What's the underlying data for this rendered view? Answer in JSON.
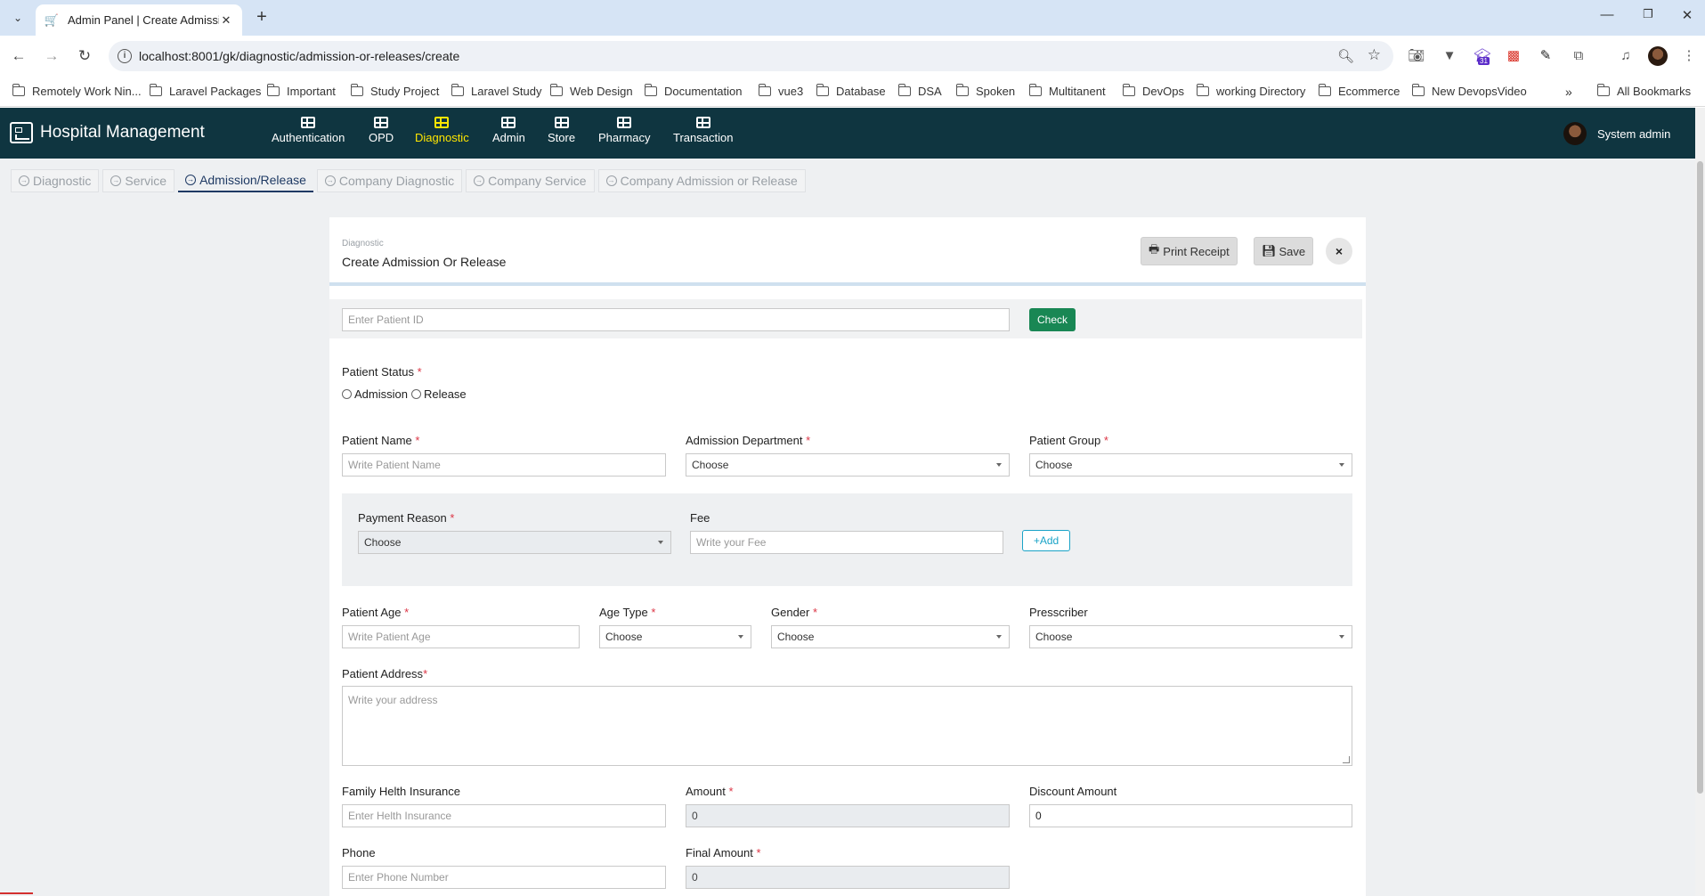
{
  "browser": {
    "tab_title": "Admin Panel | Create Admission",
    "url": "localhost:8001/gk/diagnostic/admission-or-releases/create",
    "calendar_badge": "31",
    "bookmarks": [
      "Remotely Work Nin...",
      "Laravel Packages",
      "Important",
      "Study Project",
      "Laravel Study",
      "Web Design",
      "Documentation",
      "vue3",
      "Database",
      "DSA",
      "Spoken",
      "Multitanent",
      "DevOps",
      "working Directory",
      "Ecommerce",
      "New DevopsVideo"
    ],
    "all_bookmarks": "All Bookmarks"
  },
  "header": {
    "brand": "Hospital Management",
    "nav": [
      "Authentication",
      "OPD",
      "Diagnostic",
      "Admin",
      "Store",
      "Pharmacy",
      "Transaction"
    ],
    "active_nav": "Diagnostic",
    "user": "System admin"
  },
  "subnav": [
    "Diagnostic",
    "Service",
    "Admission/Release",
    "Company Diagnostic",
    "Company Service",
    "Company Admission or Release"
  ],
  "card": {
    "breadcrumb": "Diagnostic",
    "title": "Create Admission Or Release",
    "print_label": "Print Receipt",
    "save_label": "Save",
    "close_label": "×"
  },
  "form": {
    "patient_id_placeholder": "Enter Patient ID",
    "check_label": "Check",
    "patient_status_label": "Patient Status",
    "status_options": [
      "Admission",
      "Release"
    ],
    "patient_name_label": "Patient Name",
    "patient_name_placeholder": "Write Patient Name",
    "admission_department_label": "Admission Department",
    "patient_group_label": "Patient Group",
    "choose": "Choose",
    "payment_reason_label": "Payment Reason",
    "fee_label": "Fee",
    "fee_placeholder": "Write your Fee",
    "add_label": "Add",
    "patient_age_label": "Patient Age",
    "patient_age_placeholder": "Write Patient Age",
    "age_type_label": "Age Type",
    "gender_label": "Gender",
    "prescriber_label": "Presscriber",
    "address_label": "Patient Address",
    "address_placeholder": "Write your address",
    "insurance_label": "Family Helth Insurance",
    "insurance_placeholder": "Enter Helth Insurance",
    "amount_label": "Amount",
    "amount_value": "0",
    "discount_label": "Discount Amount",
    "discount_value": "0",
    "phone_label": "Phone",
    "phone_placeholder": "Enter Phone Number",
    "final_amount_label": "Final Amount",
    "final_amount_value": "0"
  },
  "colors": {
    "header_bg": "#0f3540",
    "active_nav": "#ffe600",
    "check_button": "#198754",
    "add_button": "#1aa3c7",
    "required": "#dc3545"
  }
}
